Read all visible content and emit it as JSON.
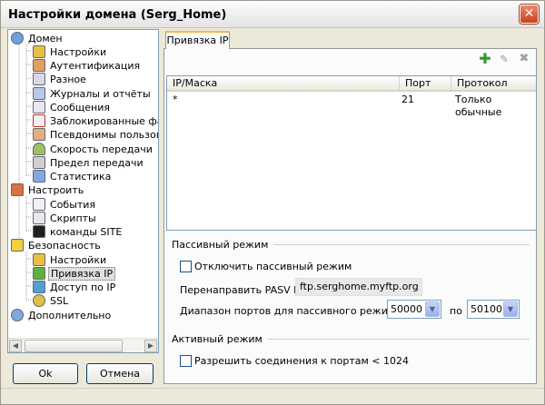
{
  "window": {
    "title": "Настройки домена (Serg_Home)"
  },
  "tree": {
    "items": [
      {
        "label": "Домен",
        "icon": "domain-globe-icon"
      },
      {
        "label": "Настройки",
        "icon": "settings-icon"
      },
      {
        "label": "Аутентификация",
        "icon": "authentication-icon"
      },
      {
        "label": "Разное",
        "icon": "misc-icon"
      },
      {
        "label": "Журналы и отчёты",
        "icon": "logs-icon"
      },
      {
        "label": "Сообщения",
        "icon": "messages-icon"
      },
      {
        "label": "Заблокированные файлы",
        "icon": "blocked-files-icon"
      },
      {
        "label": "Псевдонимы пользовател",
        "icon": "aliases-icon"
      },
      {
        "label": "Скорость передачи",
        "icon": "speed-icon"
      },
      {
        "label": "Предел передачи",
        "icon": "transfer-limit-icon"
      },
      {
        "label": "Статистика",
        "icon": "statistics-icon"
      },
      {
        "label": "Настроить",
        "icon": "configure-icon"
      },
      {
        "label": "События",
        "icon": "events-icon"
      },
      {
        "label": "Скрипты",
        "icon": "scripts-icon"
      },
      {
        "label": "команды SITE",
        "icon": "site-commands-icon"
      },
      {
        "label": "Безопасность",
        "icon": "security-icon"
      },
      {
        "label": "Настройки",
        "icon": "settings-icon"
      },
      {
        "label": "Привязка IP",
        "icon": "ip-binding-icon"
      },
      {
        "label": "Доступ по IP",
        "icon": "ip-access-icon"
      },
      {
        "label": "SSL",
        "icon": "ssl-key-icon"
      },
      {
        "label": "Дополнительно",
        "icon": "advanced-icon"
      }
    ]
  },
  "buttons": {
    "ok": "Ok",
    "cancel": "Отмена"
  },
  "tab": {
    "label": "Привязка IP"
  },
  "toolbar": {
    "add_icon": "plus-icon",
    "edit_icon": "pencil-icon",
    "delete_icon": "delete-x-icon"
  },
  "grid": {
    "columns": [
      "IP/Маска",
      "Порт",
      "Протокол"
    ],
    "rows": [
      [
        "*",
        "21",
        "Только обычные"
      ]
    ]
  },
  "passive": {
    "group_title": "Пассивный режим",
    "disable_label": "Отключить пассивный режим",
    "disable_checked": false,
    "redirect_label": "Перенаправить PASV IP",
    "redirect_value": "ftp.serghome.myftp.org",
    "range_label": "Диапазон портов для пассивного режима",
    "range_from": "50000",
    "range_to_label": "по",
    "range_to": "50100"
  },
  "active": {
    "group_title": "Активный режим",
    "allow_label": "Разрешить соединения к портам < 1024",
    "allow_checked": false
  },
  "colors": {
    "accent": "#f7b64a",
    "add_green": "#2e9a2e",
    "border_blue": "#7f9db9"
  }
}
